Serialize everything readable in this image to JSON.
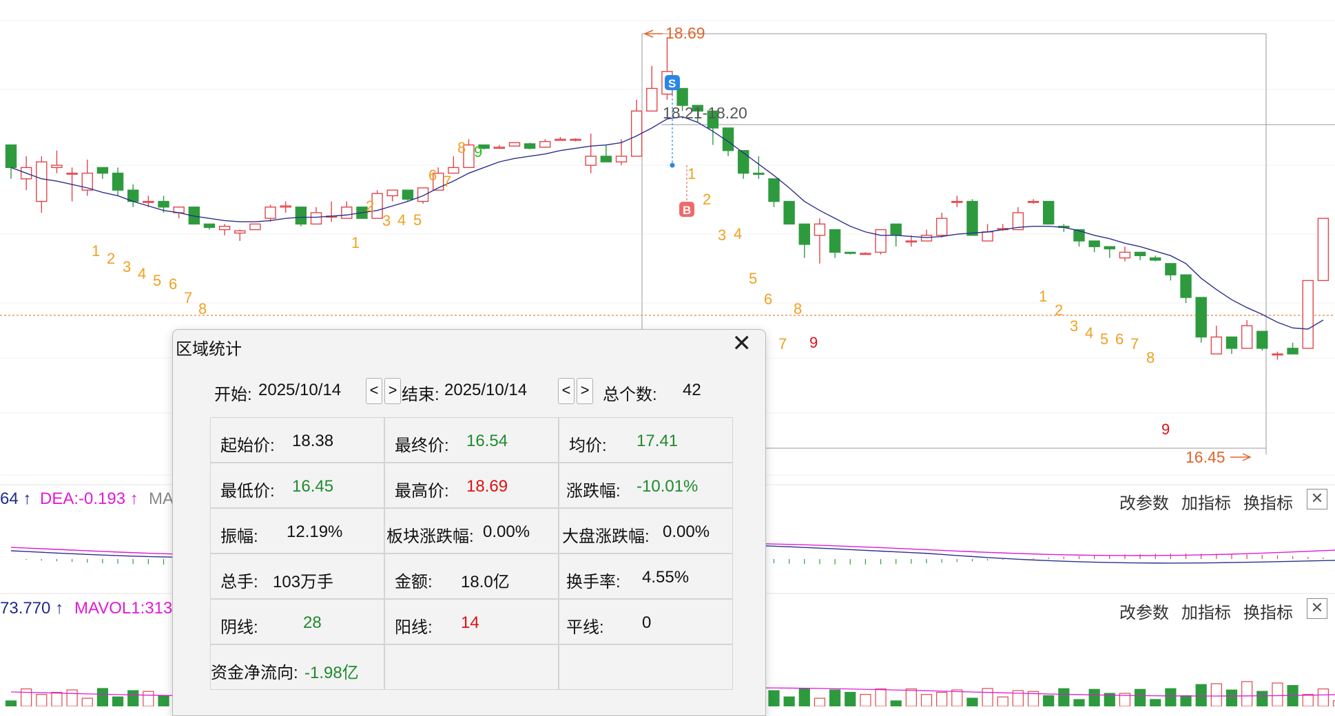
{
  "candles": [
    [
      19.1,
      18.9,
      19.0,
      18.8
    ],
    [
      18.8,
      18.9,
      19.0,
      18.7
    ],
    [
      18.6,
      18.95,
      19.0,
      18.5
    ],
    [
      18.9,
      18.92,
      19.05,
      18.85
    ],
    [
      18.85,
      18.85,
      18.9,
      18.6
    ],
    [
      18.7,
      18.85,
      18.97,
      18.65
    ],
    [
      18.9,
      18.85,
      18.9,
      18.8
    ],
    [
      18.85,
      18.7,
      18.9,
      18.65
    ],
    [
      18.7,
      18.6,
      18.75,
      18.55
    ],
    [
      18.6,
      18.6,
      18.65,
      18.55
    ],
    [
      18.6,
      18.55,
      18.65,
      18.5
    ],
    [
      18.5,
      18.55,
      18.55,
      18.45
    ],
    [
      18.55,
      18.4,
      18.55,
      18.4
    ],
    [
      18.4,
      18.37,
      18.4,
      18.35
    ],
    [
      18.35,
      18.38,
      18.4,
      18.3
    ],
    [
      18.32,
      18.34,
      18.35,
      18.25
    ],
    [
      18.35,
      18.4,
      18.4,
      18.35
    ],
    [
      18.45,
      18.55,
      18.57,
      18.42
    ],
    [
      18.55,
      18.56,
      18.6,
      18.5
    ],
    [
      18.55,
      18.4,
      18.55,
      18.38
    ],
    [
      18.4,
      18.5,
      18.55,
      18.4
    ],
    [
      18.47,
      18.47,
      18.6,
      18.42
    ],
    [
      18.45,
      18.55,
      18.6,
      18.45
    ],
    [
      18.55,
      18.45,
      18.55,
      18.45
    ],
    [
      18.45,
      18.67,
      18.7,
      18.45
    ],
    [
      18.65,
      18.7,
      18.7,
      18.6
    ],
    [
      18.7,
      18.62,
      18.7,
      18.6
    ],
    [
      18.6,
      18.72,
      18.72,
      18.58
    ],
    [
      18.7,
      18.85,
      18.9,
      18.7
    ],
    [
      18.85,
      18.9,
      19.0,
      18.85
    ],
    [
      18.9,
      19.1,
      19.15,
      18.9
    ],
    [
      19.1,
      19.07,
      19.1,
      19.06
    ],
    [
      19.07,
      19.08,
      19.1,
      19.07
    ],
    [
      19.09,
      19.12,
      19.12,
      19.09
    ],
    [
      19.11,
      19.07,
      19.12,
      19.06
    ],
    [
      19.08,
      19.13,
      19.15,
      19.08
    ],
    [
      19.14,
      19.15,
      19.17,
      19.14
    ],
    [
      19.15,
      19.15,
      19.16,
      19.13
    ],
    [
      18.92,
      19.0,
      19.2,
      18.85
    ],
    [
      19.0,
      18.95,
      19.1,
      18.95
    ],
    [
      18.95,
      19.0,
      19.15,
      18.92
    ],
    [
      19.0,
      19.4,
      19.5,
      19.0
    ],
    [
      19.4,
      19.6,
      19.8,
      19.45
    ],
    [
      19.55,
      19.75,
      20.05,
      19.5
    ],
    [
      19.6,
      19.45,
      19.6,
      19.4
    ],
    [
      19.45,
      19.4,
      19.45,
      19.3
    ],
    [
      19.4,
      19.25,
      19.4,
      19.1
    ],
    [
      19.25,
      19.05,
      19.25,
      19.0
    ],
    [
      19.05,
      18.85,
      19.05,
      18.8
    ],
    [
      18.85,
      18.84,
      19.0,
      18.8
    ],
    [
      18.8,
      18.6,
      18.8,
      18.55
    ],
    [
      18.6,
      18.4,
      18.6,
      18.4
    ],
    [
      18.4,
      18.22,
      18.4,
      18.1
    ],
    [
      18.3,
      18.4,
      18.45,
      18.05
    ],
    [
      18.35,
      18.15,
      18.35,
      18.1
    ],
    [
      18.15,
      18.14,
      18.15,
      18.13
    ],
    [
      18.14,
      18.14,
      18.15,
      18.13
    ],
    [
      18.15,
      18.35,
      18.35,
      18.13
    ],
    [
      18.4,
      18.3,
      18.4,
      18.2
    ],
    [
      18.25,
      18.25,
      18.3,
      18.2
    ],
    [
      18.25,
      18.3,
      18.35,
      18.25
    ],
    [
      18.3,
      18.45,
      18.5,
      18.28
    ],
    [
      18.6,
      18.6,
      18.65,
      18.55
    ],
    [
      18.6,
      18.3,
      18.62,
      18.3
    ],
    [
      18.25,
      18.33,
      18.4,
      18.25
    ],
    [
      18.35,
      18.36,
      18.4,
      18.34
    ],
    [
      18.35,
      18.5,
      18.55,
      18.35
    ],
    [
      18.6,
      18.6,
      18.62,
      18.58
    ],
    [
      18.6,
      18.4,
      18.6,
      18.4
    ],
    [
      18.38,
      18.37,
      18.4,
      18.33
    ],
    [
      18.35,
      18.25,
      18.35,
      18.2
    ],
    [
      18.25,
      18.2,
      18.25,
      18.15
    ],
    [
      18.2,
      18.18,
      18.2,
      18.1
    ],
    [
      18.1,
      18.15,
      18.2,
      18.07
    ],
    [
      18.15,
      18.12,
      18.15,
      18.08
    ],
    [
      18.1,
      18.08,
      18.12,
      18.07
    ],
    [
      18.05,
      17.95,
      18.05,
      17.9
    ],
    [
      17.95,
      17.75,
      17.95,
      17.7
    ],
    [
      17.75,
      17.4,
      17.75,
      17.35
    ],
    [
      17.25,
      17.4,
      17.5,
      17.25
    ],
    [
      17.4,
      17.3,
      17.4,
      17.25
    ],
    [
      17.3,
      17.5,
      17.55,
      17.3
    ],
    [
      17.45,
      17.3,
      17.45,
      17.28
    ],
    [
      17.25,
      17.25,
      17.27,
      17.2
    ],
    [
      17.3,
      17.25,
      17.35,
      17.25
    ],
    [
      17.3,
      17.9,
      17.9,
      17.3
    ],
    [
      17.9,
      18.45,
      18.45,
      17.9
    ]
  ],
  "ma": [
    18.9,
    18.85,
    18.8,
    18.78,
    18.75,
    18.72,
    18.68,
    18.65,
    18.6,
    18.56,
    18.52,
    18.5,
    18.47,
    18.45,
    18.43,
    18.42,
    18.42,
    18.43,
    18.45,
    18.46,
    18.46,
    18.47,
    18.48,
    18.5,
    18.52,
    18.56,
    18.6,
    18.65,
    18.72,
    18.78,
    18.85,
    18.9,
    18.95,
    18.98,
    19.0,
    19.02,
    19.05,
    19.07,
    19.09,
    19.1,
    19.12,
    19.18,
    19.25,
    19.33,
    19.35,
    19.3,
    19.22,
    19.13,
    19.03,
    18.93,
    18.83,
    18.72,
    18.6,
    18.52,
    18.45,
    18.38,
    18.33,
    18.3,
    18.3,
    18.29,
    18.28,
    18.29,
    18.31,
    18.32,
    18.33,
    18.35,
    18.37,
    18.38,
    18.38,
    18.37,
    18.34,
    18.3,
    18.27,
    18.23,
    18.2,
    18.16,
    18.12,
    18.05,
    17.92,
    17.82,
    17.73,
    17.66,
    17.6,
    17.53,
    17.48,
    17.47,
    17.55
  ],
  "markers": {
    "high_label": "18.69",
    "low_label": "16.45",
    "span_label": "18.21-18.20",
    "sell_tag": "S",
    "buy_tag": "B",
    "nine_up_1": "8",
    "nine_up_2": "9",
    "nine_dn": "9",
    "nine_dn_2": "9",
    "nine_dn_3": "9"
  },
  "count_labels": [
    [
      "1",
      "orange",
      133,
      372
    ],
    [
      "2",
      "orange",
      155,
      383
    ],
    [
      "3",
      "orange",
      178,
      395
    ],
    [
      "4",
      "orange",
      200,
      405
    ],
    [
      "5",
      "orange",
      222,
      415
    ],
    [
      "6",
      "orange",
      245,
      420
    ],
    [
      "7",
      "orange",
      267,
      440
    ],
    [
      "8",
      "orange",
      288,
      456
    ],
    [
      "1",
      "orange",
      510,
      360
    ],
    [
      "2",
      "orange",
      531,
      307
    ],
    [
      "3",
      "orange",
      555,
      328
    ],
    [
      "4",
      "orange",
      577,
      327
    ],
    [
      "5",
      "orange",
      600,
      327
    ],
    [
      "6",
      "orange",
      622,
      262
    ],
    [
      "7",
      "orange",
      643,
      271
    ],
    [
      "8",
      "orange",
      664,
      222
    ],
    [
      "9",
      "green",
      688,
      228
    ],
    [
      "1",
      "orange",
      998,
      260
    ],
    [
      "2",
      "orange",
      1020,
      297
    ],
    [
      "3",
      "orange",
      1042,
      349
    ],
    [
      "4",
      "orange",
      1065,
      347
    ],
    [
      "5",
      "orange",
      1087,
      412
    ],
    [
      "6",
      "orange",
      1109,
      442
    ],
    [
      "7",
      "orange",
      1130,
      507
    ],
    [
      "8",
      "orange",
      1152,
      456
    ],
    [
      "9",
      "red",
      1175,
      505
    ],
    [
      "1",
      "orange",
      1508,
      438
    ],
    [
      "2",
      "orange",
      1531,
      458
    ],
    [
      "3",
      "orange",
      1553,
      481
    ],
    [
      "4",
      "orange",
      1575,
      491
    ],
    [
      "5",
      "orange",
      1597,
      500
    ],
    [
      "6",
      "orange",
      1619,
      500
    ],
    [
      "7",
      "orange",
      1641,
      507
    ],
    [
      "8",
      "orange",
      1664,
      527
    ],
    [
      "9",
      "red",
      1686,
      631
    ]
  ],
  "ind1": {
    "left_text": "64 ↑",
    "dea": "DEA:-0.193 ↑",
    "ma_tail": "MA",
    "btn_params": "改参数",
    "btn_add": "加指标",
    "btn_switch": "换指标",
    "close": "✕"
  },
  "ind2": {
    "left_text": "73.770 ↑",
    "mavol": "MAVOL1:313",
    "btn_params": "改参数",
    "btn_add": "加指标",
    "btn_switch": "换指标",
    "close": "✕"
  },
  "dialog": {
    "title": "区域统计",
    "close": "✕",
    "start_label": "开始:",
    "start_date": "2025/10/14",
    "end_label": "结束:",
    "end_date": "2025/10/14",
    "prev": "<",
    "next": ">",
    "total_label": "总个数:",
    "total": "42",
    "open_label": "起始价:",
    "open": "18.38",
    "close_label": "最终价:",
    "close_val": "16.54",
    "avg_label": "均价:",
    "avg": "17.41",
    "low_label": "最低价:",
    "low": "16.45",
    "high_label": "最高价:",
    "high": "18.69",
    "chg_label": "涨跌幅:",
    "chg": "-10.01%",
    "amp_label": "振幅:",
    "amp": "12.19%",
    "sector_label": "板块涨跌幅:",
    "sector": "0.00%",
    "market_label": "大盘涨跌幅:",
    "market": "0.00%",
    "vol_label": "总手:",
    "vol": "103万手",
    "amount_label": "金额:",
    "amount": "18.0亿",
    "turnover_label": "换手率:",
    "turnover": "4.55%",
    "down_label": "阴线:",
    "down": "28",
    "up_label": "阳线:",
    "up": "14",
    "flat_label": "平线:",
    "flat": "0",
    "flow_label": "资金净流向:",
    "flow": "-1.98亿"
  },
  "colors": {
    "up": "#e0454a",
    "down": "#2e9a3e",
    "ma": "#2b2f8a",
    "orange": "#f0a020",
    "accent_orange": "#e0652a",
    "dea": "#e11ad8"
  }
}
